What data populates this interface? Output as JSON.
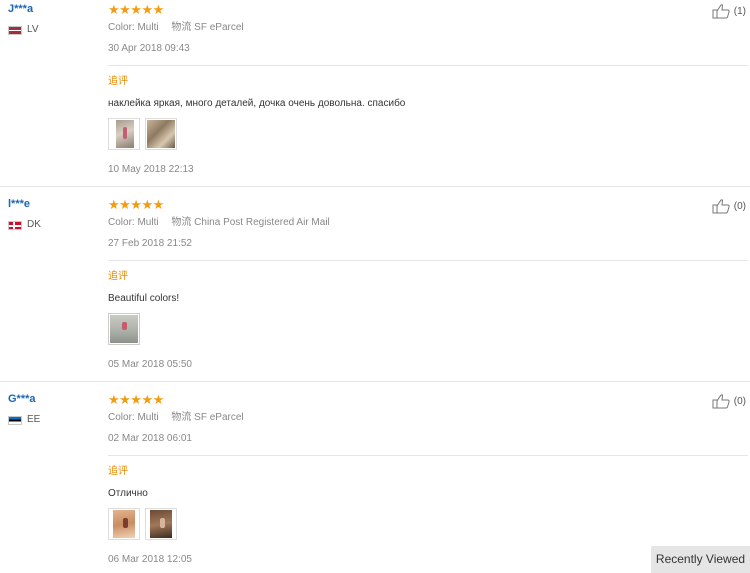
{
  "labels": {
    "color": "Color:",
    "shipping": "物流",
    "follow_up": "追评"
  },
  "reviews": [
    {
      "user": "J***a",
      "country": "LV",
      "flag": "lv",
      "stars": "★★★★★",
      "color": "Multi",
      "shipping": "SF eParcel",
      "date": "30 Apr 2018 09:43",
      "likes": "(1)",
      "follow_text": "наклейка яркая, много деталей, дочка очень довольна. спасибо",
      "follow_date": "10 May 2018 22:13",
      "images": 2
    },
    {
      "user": "l***e",
      "country": "DK",
      "flag": "dk",
      "stars": "★★★★★",
      "color": "Multi",
      "shipping": "China Post Registered Air Mail",
      "date": "27 Feb 2018 21:52",
      "likes": "(0)",
      "follow_text": "Beautiful colors!",
      "follow_date": "05 Mar 2018 05:50",
      "images": 1
    },
    {
      "user": "G***a",
      "country": "EE",
      "flag": "ee",
      "stars": "★★★★★",
      "color": "Multi",
      "shipping": "SF eParcel",
      "date": "02 Mar 2018 06:01",
      "likes": "(0)",
      "follow_text": "Отлично",
      "follow_date": "06 Mar 2018 12:05",
      "images": 2
    }
  ],
  "recently_viewed": "Recently Viewed",
  "colors": {
    "username": "#1a66b3",
    "stars": "#f39c12",
    "follow_up": "#e68a00"
  }
}
